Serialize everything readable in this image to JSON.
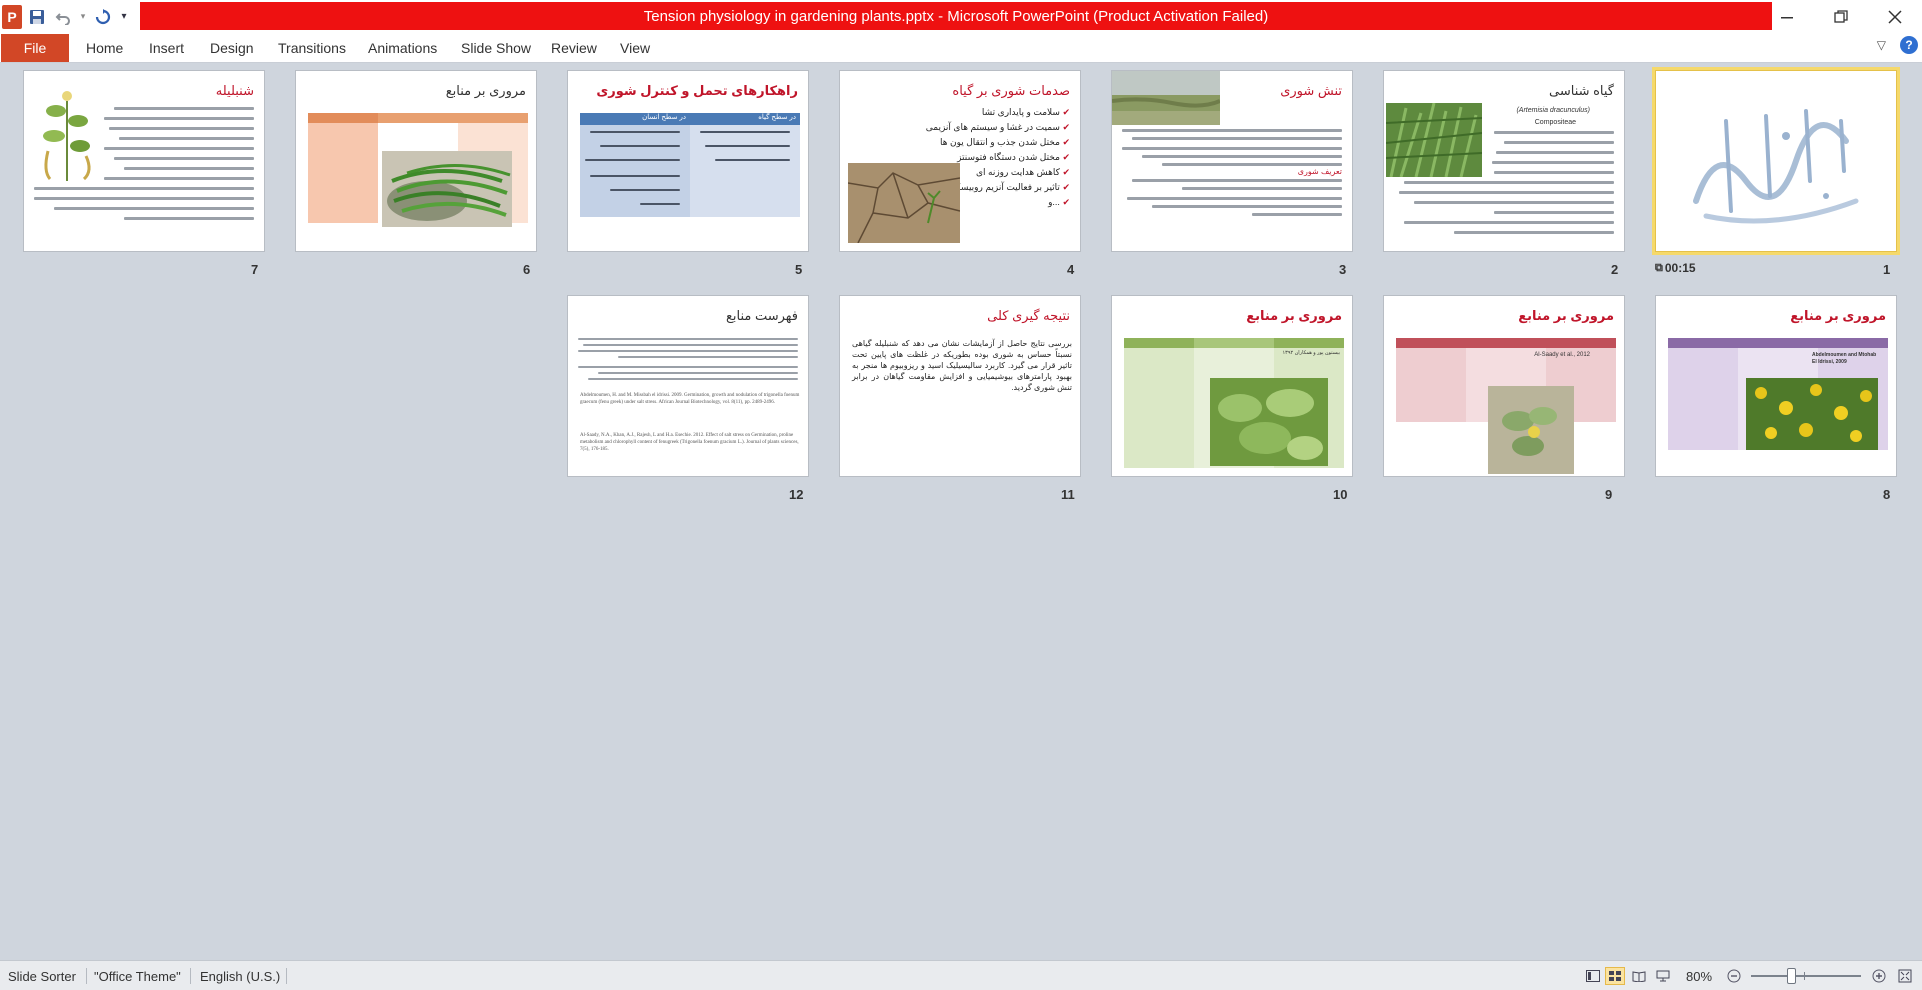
{
  "window": {
    "title": "Tension physiology in gardening plants.pptx  -  Microsoft PowerPoint (Product Activation Failed)",
    "app_icon_letter": "P",
    "accent": "#d24726",
    "title_bg": "#ee1111"
  },
  "qat": {
    "save_icon": "save-icon",
    "undo_icon": "undo-icon",
    "redo_icon": "redo-icon",
    "customize_icon": "customize-icon"
  },
  "ribbon": {
    "file": "File",
    "tabs": [
      "Home",
      "Insert",
      "Design",
      "Transitions",
      "Animations",
      "Slide Show",
      "Review",
      "View"
    ]
  },
  "slides": [
    {
      "num": "1",
      "title": "",
      "timing": "00:15"
    },
    {
      "num": "2",
      "title": "گیاه شناسی"
    },
    {
      "num": "3",
      "title": "تنش شوری"
    },
    {
      "num": "4",
      "title": "صدمات شوری بر گیاه"
    },
    {
      "num": "5",
      "title": "راهکارهای تحمل و کنترل شوری"
    },
    {
      "num": "6",
      "title": "مروری بر منابع"
    },
    {
      "num": "7",
      "title": "شنبلیله"
    },
    {
      "num": "8",
      "title": "مروری بر منابع"
    },
    {
      "num": "9",
      "title": "مروری بر منابع"
    },
    {
      "num": "10",
      "title": "مروری بر منابع"
    },
    {
      "num": "11",
      "title": "نتیجه گیری کلی"
    },
    {
      "num": "12",
      "title": "فهرست منابع"
    }
  ],
  "slide_text": {
    "s2_latin": "(Artemisia dracunculus)",
    "s2_family": "Compositeae",
    "s3_def": "تعریف شوری",
    "s4_items": [
      "سلامت و پایداری تشا",
      "سمیت در غشا و سیستم های آنزیمی",
      "مختل شدن جذب و انتقال یون ها",
      "مختل شدن دستگاه فتوسنتز",
      "کاهش هدایت روزنه ای",
      "تاثیر بر فعالیت آنزیم روبیسکو",
      "و..."
    ],
    "s5_h1": "در سطح گیاه",
    "s5_h2": "در سطح انسان",
    "s7_latin": "Trigonella foenum-graecum",
    "s7_family": "Fabaceae",
    "s8_head": "Abdelmoumen and Mtohab El Idrissi, 2009",
    "s9_head": "Al-Saady et al., 2012",
    "s10_head": "بیستون پور و همکاران ۱۳۹۲",
    "s11_text": "بررسی نتایج حاصل از آزمایشات نشان می دهد که شنبلیله گیاهی نسبتاً حساس به شوری بوده بطوریکه در غلظت های پایین تحت تاثیر قرار می گیرد. کاربرد سالیسیلیک اسید و ریزوبیوم ها منجر به بهبود پارامترهای بیوشیمیایی و افزایش مقاومت گیاهان در برابر تنش شوری گردید.",
    "s12_ref1": "Abdelmoumen, H. and M. Missbah el idrissi. 2009. Germination, growth and nodulation of trigonella foenum graecum (fenu greek) under salt stress. African Journal Biotechnology, vol. 8(11), pp. 2489-2496.",
    "s12_ref2": "Al-Saady, N.A., Khan, A.J., Rajesh, L and H.a. Esechie. 2012. Effect of salt stress on Germination, proline metabolism and chlorophyll content of fenugreek (Trigonella foenum gracium L.). Journal of plants sciences, 7(5), 176-185."
  },
  "status": {
    "view": "Slide Sorter",
    "theme": "\"Office Theme\"",
    "language": "English (U.S.)",
    "zoom": "80%",
    "zoom_level_percent": 80
  }
}
